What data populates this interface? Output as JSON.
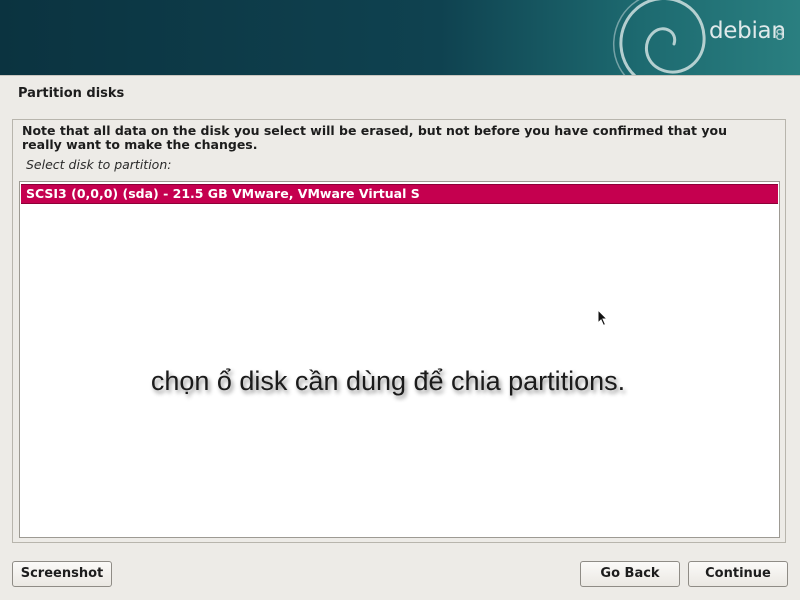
{
  "header": {
    "brand": "debian",
    "version": "8",
    "logo_icon": "debian-swirl-icon",
    "colors": {
      "banner_start": "#0b3340",
      "banner_end": "#2a7f80"
    }
  },
  "page": {
    "title": "Partition disks",
    "note": "Note that all data on the disk you select will be erased, but not before you have confirmed that you really want to make the changes.",
    "prompt": "Select disk to partition:"
  },
  "disk_list": {
    "items": [
      {
        "label": "SCSI3 (0,0,0) (sda) - 21.5 GB VMware, VMware Virtual S",
        "selected": true
      }
    ],
    "selection_color": "#c5004f"
  },
  "overlay": {
    "caption": "chọn ổ disk cần dùng để chia partitions.",
    "cursor_icon": "mouse-pointer-icon"
  },
  "buttons": {
    "screenshot": "Screenshot",
    "go_back": "Go Back",
    "continue": "Continue"
  }
}
